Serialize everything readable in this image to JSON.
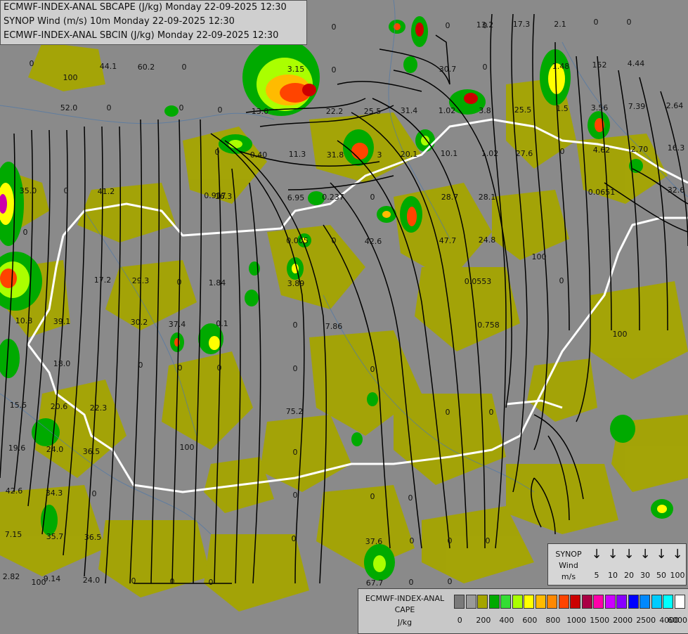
{
  "title_lines": [
    "ECMWF-INDEX-ANAL SBCAPE (J/kg) Monday 22-09-2025 12:30",
    "SYNOP Wind (m/s) 10m Monday 22-09-2025 12:30",
    "ECMWF-INDEX-ANAL SBCIN (J/kg) Monday 22-09-2025 12:30"
  ],
  "synop_legend": {
    "title_lines": [
      "SYNOP",
      "Wind",
      "m/s"
    ],
    "speeds": [
      "5",
      "10",
      "20",
      "30",
      "50",
      "100"
    ],
    "arrow_icon": "wind-arrow-down-icon"
  },
  "cape_legend": {
    "title_lines": [
      "ECMWF-INDEX-ANAL",
      "CAPE",
      "J/kg"
    ],
    "ticks": [
      "0",
      "200",
      "400",
      "600",
      "800",
      "1000",
      "1500",
      "2000",
      "2500",
      "4000",
      "6000"
    ],
    "colors": [
      "#7a7a7a",
      "#9a9a9a",
      "#a5a500",
      "#00aa00",
      "#33dd33",
      "#aaff00",
      "#ffff00",
      "#ffbb00",
      "#ff8800",
      "#ff4400",
      "#cc0000",
      "#aa0044",
      "#ff00aa",
      "#cc00ff",
      "#8800ff",
      "#0000ff",
      "#0088ff",
      "#00ccff",
      "#00ffff",
      "#ffffff"
    ]
  },
  "map_colors": {
    "background": "#8a8a8a",
    "cape_low": "#a5a500",
    "border": "#ffffff",
    "streamline": "#000000"
  },
  "value_labels": [
    "0",
    "44.1",
    "60.2",
    "0",
    "0",
    "0",
    "0",
    "13.2",
    "17.3",
    "2.1",
    "0",
    "0",
    "100",
    "52.0",
    "0",
    "0",
    "3.15",
    "0",
    "30.7",
    "0",
    "1.48",
    "152",
    "4.44",
    "0",
    "13.0",
    "22.2",
    "25.5",
    "31.4",
    "1.02",
    "3.8",
    "25.5",
    "1.5",
    "3.56",
    "7.39",
    "2.64",
    "0",
    "0.40",
    "11.3",
    "31.8",
    "3",
    "20.1",
    "10.1",
    "1.02",
    "27.6",
    "0",
    "4.62",
    "2.70",
    "16.3",
    "35.0",
    "0",
    "41.2",
    "0.917",
    "16.3",
    "6.95",
    "0.237",
    "0",
    "28.7",
    "28.1",
    "0.0651",
    "32.6",
    "0",
    "0.005",
    "0",
    "42.6",
    "47.7",
    "24.8",
    "100",
    "17.2",
    "29.3",
    "0",
    "1.84",
    "3.89",
    "0.0553",
    "0",
    "10.8",
    "39.1",
    "30.2",
    "37.4",
    "0.1",
    "0",
    "7.86",
    "0.758",
    "100",
    "18.0",
    "0",
    "0",
    "0",
    "0",
    "0",
    "15.5",
    "20.6",
    "22.3",
    "75.2",
    "0",
    "0",
    "19.6",
    "24.0",
    "36.5",
    "0",
    "100",
    "42.6",
    "34.3",
    "0",
    "0",
    "0",
    "0",
    "7.15",
    "35.7",
    "36.5",
    "0",
    "37.6",
    "0",
    "0",
    "0",
    "2.82",
    "9.14",
    "100",
    "24.0",
    "0",
    "0",
    "0",
    "67.7",
    "0",
    "0"
  ]
}
